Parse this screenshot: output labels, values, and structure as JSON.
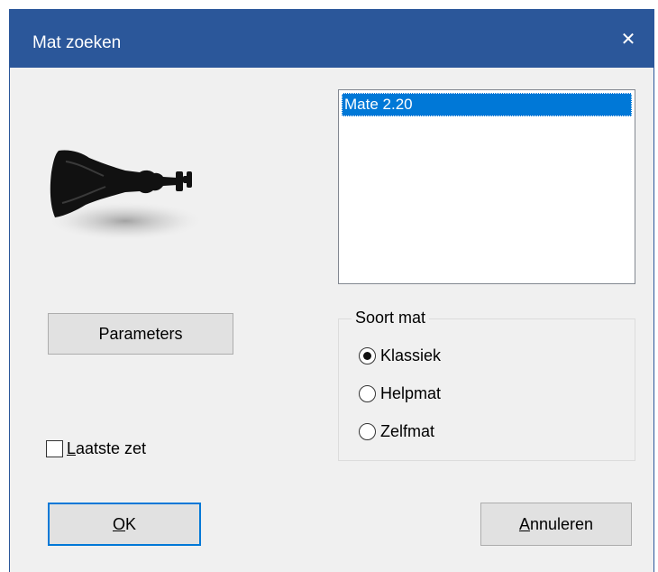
{
  "window": {
    "title": "Mat zoeken",
    "close_glyph": "✕"
  },
  "engines": {
    "items": [
      "Mate 2.20"
    ],
    "selected_index": 0
  },
  "buttons": {
    "parameters": "Parameters",
    "ok_mnemonic": "O",
    "ok_rest": "K",
    "cancel_mnemonic": "A",
    "cancel_rest": "nnuleren"
  },
  "mate_type": {
    "legend": "Soort mat",
    "options": [
      "Klassiek",
      "Helpmat",
      "Zelfmat"
    ],
    "selected": "Klassiek"
  },
  "last_move": {
    "mnemonic": "L",
    "rest": "aatste zet",
    "checked": false
  },
  "icons": {
    "piece": "fallen-king-icon"
  },
  "colors": {
    "titlebar": "#2b579a",
    "selection": "#0078d7",
    "dialog_bg": "#f0f0f0"
  }
}
